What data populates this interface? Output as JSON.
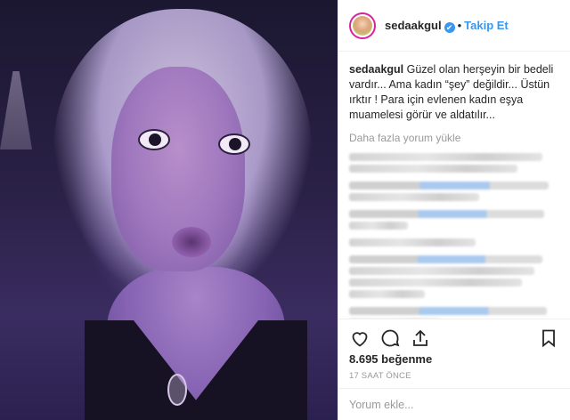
{
  "header": {
    "username": "sedaakgul",
    "verified_glyph": "✔",
    "separator": "•",
    "follow_label": "Takip Et"
  },
  "caption": {
    "username": "sedaakgul",
    "text": "Güzel olan herşeyin bir bedeli vardır... Ama kadın “şey” değildir... Üstün ırktır ! Para için evlenen kadın eşya muamelesi görür ve aldatılır..."
  },
  "comments": {
    "load_more_label": "Daha fazla yorum yükle",
    "blurred_count": 7
  },
  "actions": {
    "like_icon": "heart-icon",
    "comment_icon": "comment-icon",
    "share_icon": "share-icon",
    "save_icon": "bookmark-icon"
  },
  "likes_text": "8.695 beğenme",
  "time_text": "17 SAAT ÖNCE",
  "add_comment": {
    "placeholder": "Yorum ekle..."
  },
  "colors": {
    "accent": "#3897f0",
    "text": "#262626",
    "muted": "#999999",
    "border": "#efefef"
  }
}
